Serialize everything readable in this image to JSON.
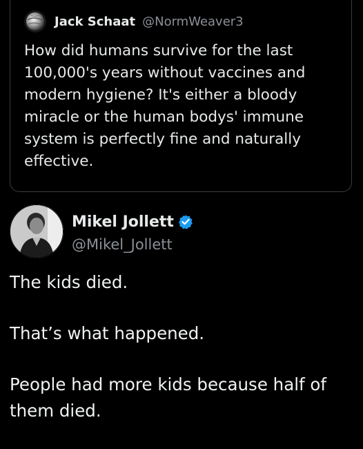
{
  "quoted_tweet": {
    "author_name": "Jack Schaat",
    "author_handle": "@NormWeaver3",
    "text": "How did humans survive for the last\n100,000's years without vaccines and\nmodern hygiene? It's either a bloody\nmiracle or the human bodys' immune\nsystem is perfectly fine and naturally\neffective.",
    "avatar_icon": "globe-icon"
  },
  "reply": {
    "author_name": "Mikel Jollett",
    "author_handle": "@Mikel_Jollett",
    "verified_icon": "verified-badge-icon",
    "verified_color": "#1d9bf0",
    "paragraphs": [
      "The kids died.",
      "That’s what happened.",
      "People had more kids because half of\nthem died."
    ]
  },
  "colors": {
    "background": "#000000",
    "text_primary": "#e7e9ea",
    "text_secondary": "#8b9097",
    "border": "#3a3d40"
  }
}
